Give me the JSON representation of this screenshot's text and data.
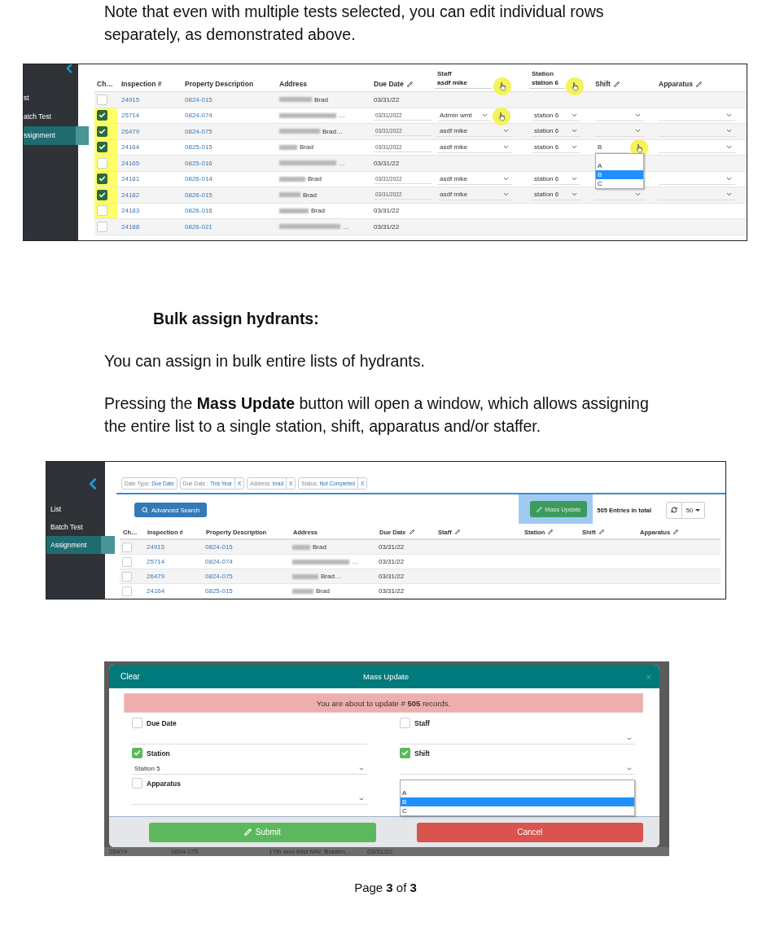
{
  "intro": "Note that even with multiple tests selected, you can edit individual rows separately, as demonstrated above.",
  "shot_1": {
    "sidebar": [
      {
        "label": "st",
        "selected": false
      },
      {
        "label": "atch Test",
        "selected": false
      },
      {
        "label": "ssignment",
        "selected": true
      }
    ],
    "columns": [
      {
        "label": "Ch…",
        "editable": false,
        "clicked": false
      },
      {
        "label": "Inspection #",
        "editable": false,
        "clicked": false
      },
      {
        "label": "Property Description",
        "editable": false,
        "clicked": false
      },
      {
        "label": "Address",
        "editable": false,
        "clicked": false
      },
      {
        "label": "Due Date",
        "editable": true,
        "clicked": false
      },
      {
        "label": "Staff",
        "editable": false,
        "filter": "asdf mike",
        "clicked": true
      },
      {
        "label": "Station",
        "editable": false,
        "filter": "station 6",
        "clicked": true
      },
      {
        "label": "Shift",
        "editable": true,
        "clicked": false
      },
      {
        "label": "Apparatus",
        "editable": true,
        "clicked": false
      }
    ],
    "rows": [
      {
        "kind": "plain",
        "checked": false,
        "highlighted": false,
        "inspection": "24915",
        "property": "0824-015",
        "address": "Brad",
        "due_date": "03/31/22"
      },
      {
        "kind": "editing",
        "checked": true,
        "highlighted": true,
        "inspection": "25714",
        "property": "0824-074",
        "address": "…",
        "due_date": "03/31/2022",
        "staff": "Admin wmt",
        "station": "station 6",
        "staff_clicked": true,
        "shift_clicked": false
      },
      {
        "kind": "editing",
        "checked": true,
        "highlighted": true,
        "inspection": "26479",
        "property": "0824-075",
        "address": "Brad…",
        "due_date": "03/31/2022",
        "staff": "asdf mike",
        "station": "station 6",
        "staff_clicked": false,
        "shift_clicked": false
      },
      {
        "kind": "editing",
        "checked": true,
        "highlighted": true,
        "inspection": "24164",
        "property": "0825-015",
        "address": "Brad",
        "due_date": "03/31/2022",
        "staff": "asdf mike",
        "station": "station 6",
        "shift": "B",
        "staff_clicked": false,
        "shift_clicked": true,
        "shift_options": [
          {
            "label": "A",
            "selected": false
          },
          {
            "label": "B",
            "selected": true
          },
          {
            "label": "C",
            "selected": false
          }
        ]
      },
      {
        "kind": "plain",
        "checked": false,
        "highlighted": true,
        "inspection": "24165",
        "property": "0825-016",
        "address": "…",
        "due_date": "03/31/22"
      },
      {
        "kind": "editing",
        "checked": true,
        "highlighted": true,
        "inspection": "24181",
        "property": "0826-014",
        "address": "Brad",
        "due_date": "03/31/2022",
        "staff": "asdf mike",
        "station": "station 6",
        "staff_clicked": false
      },
      {
        "kind": "editing",
        "checked": true,
        "highlighted": true,
        "inspection": "24182",
        "property": "0826-015",
        "address": "Brad",
        "due_date": "03/31/2022",
        "staff": "asdf mike",
        "station": "station 6",
        "staff_clicked": false,
        "shift_clicked": false
      },
      {
        "kind": "plain",
        "checked": false,
        "highlighted": true,
        "inspection": "24183",
        "property": "0826-016",
        "address": "Brad",
        "due_date": "03/31/22"
      },
      {
        "kind": "plain",
        "checked": false,
        "highlighted": false,
        "inspection": "24188",
        "property": "0826-021",
        "address": "…",
        "due_date": "03/31/22"
      }
    ]
  },
  "heading": "Bulk assign hydrants:",
  "para_1": "You can assign in bulk entire lists of hydrants.",
  "para_2": "Pressing the **Mass Update** button will open a window, which allows assigning the entire list to a single station, shift, apparatus and/or staffer.",
  "shot_2": {
    "sidebar": [
      {
        "label": "List",
        "selected": false
      },
      {
        "label": "Batch Test",
        "selected": false
      },
      {
        "label": "Assignment",
        "selected": true
      }
    ],
    "filters": [
      {
        "label": "Date Type:",
        "value": "Due Date"
      },
      {
        "label": "Due Date :",
        "value": "This Year",
        "remove": "X"
      },
      {
        "label": "Address:",
        "value": "brad",
        "remove": "X"
      },
      {
        "label": "Status:",
        "value": "Not Completed",
        "remove": "X"
      }
    ],
    "advanced_search": "Advanced Search",
    "mass_update": {
      "label": "Mass Update",
      "highlighted": true
    },
    "entries": "505 Entries in total",
    "page_size": "50",
    "columns": [
      {
        "label": "Ch…",
        "editable": false
      },
      {
        "label": "Inspection #",
        "editable": false
      },
      {
        "label": "Property Description",
        "editable": false
      },
      {
        "label": "Address",
        "editable": false
      },
      {
        "label": "Due Date",
        "editable": true
      },
      {
        "label": "Staff",
        "editable": true
      },
      {
        "label": "Station",
        "editable": true
      },
      {
        "label": "Shift",
        "editable": true
      },
      {
        "label": "Apparatus",
        "editable": true
      }
    ],
    "rows": [
      {
        "checked": false,
        "inspection": "24915",
        "property": "0824-015",
        "address": "Brad",
        "due_date": "03/31/22"
      },
      {
        "checked": false,
        "inspection": "25714",
        "property": "0824-074",
        "address": "…",
        "due_date": "03/31/22"
      },
      {
        "checked": false,
        "inspection": "26479",
        "property": "0824-075",
        "address": "Brad…",
        "due_date": "03/31/22"
      },
      {
        "checked": false,
        "inspection": "24164",
        "property": "0825-015",
        "address": "Brad",
        "due_date": "03/31/22"
      }
    ]
  },
  "shot_3": {
    "clear": "Clear",
    "title": "Mass Update",
    "close": "×",
    "alert": "You are about to update # **505** records.",
    "fields": [
      {
        "label": "Due Date",
        "kind": "input",
        "checked": false
      },
      {
        "label": "Station",
        "kind": "select",
        "checked": true,
        "value": "Station 5"
      },
      {
        "label": "Apparatus",
        "kind": "select",
        "checked": false
      },
      {
        "label": "Staff",
        "kind": "select",
        "checked": false
      },
      {
        "label": "Shift",
        "kind": "select",
        "checked": true,
        "options": [
          {
            "label": "A",
            "selected": false
          },
          {
            "label": "B",
            "selected": true
          },
          {
            "label": "C",
            "selected": false
          }
        ]
      }
    ],
    "submit": "Submit",
    "cancel": "Cancel",
    "background_row": [
      "26479",
      "0824-075",
      "17th and 99st NW, Braden…",
      "03/31/22"
    ]
  },
  "footer": "Page **3** of **3**"
}
